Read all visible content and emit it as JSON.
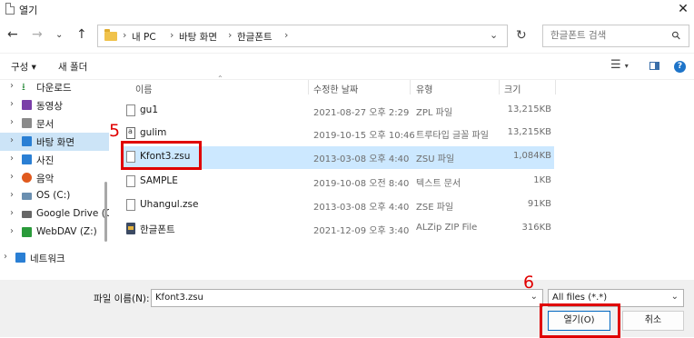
{
  "window": {
    "title": "열기",
    "close_icon": "close-icon"
  },
  "address": {
    "crumbs": [
      "내 PC",
      "바탕 화면",
      "한글폰트"
    ],
    "separator": "›"
  },
  "search": {
    "placeholder": "한글폰트 검색"
  },
  "toolbar": {
    "organize_label": "구성 ▾",
    "new_folder_label": "새 폴더"
  },
  "sidebar": {
    "items": [
      {
        "label": "다운로드",
        "icon": "download-icon",
        "color": "#2a8c3c"
      },
      {
        "label": "동영상",
        "icon": "video-icon",
        "color": "#7a3ea8"
      },
      {
        "label": "문서",
        "icon": "document-icon",
        "color": "#7a7a7a"
      },
      {
        "label": "바탕 화면",
        "icon": "desktop-icon",
        "color": "#2a7fd4"
      },
      {
        "label": "사진",
        "icon": "pictures-icon",
        "color": "#2a7fd4"
      },
      {
        "label": "음악",
        "icon": "music-icon",
        "color": "#e05a1e"
      },
      {
        "label": "OS (C:)",
        "icon": "drive-icon",
        "color": "#6a8fb0"
      },
      {
        "label": "Google Drive (G",
        "icon": "drive-icon",
        "color": "#555555"
      },
      {
        "label": "WebDAV (Z:)",
        "icon": "network-drive-icon",
        "color": "#2a9a3a"
      },
      {
        "label": "네트워크",
        "icon": "network-icon",
        "color": "#2a7fd4"
      }
    ]
  },
  "columns": {
    "name": "이름",
    "modified": "수정한 날짜",
    "type": "유형",
    "size": "크기"
  },
  "files": [
    {
      "name": "gu1",
      "modified": "2021-08-27 오후 2:29",
      "type": "ZPL 파일",
      "size": "13,215KB",
      "icon": "file-icon"
    },
    {
      "name": "gulim",
      "modified": "2019-10-15 오후 10:46",
      "type": "트루타입 글꼴 파일",
      "size": "13,215KB",
      "icon": "font-file-icon"
    },
    {
      "name": "Kfont3.zsu",
      "modified": "2013-03-08 오후 4:40",
      "type": "ZSU 파일",
      "size": "1,084KB",
      "icon": "file-icon"
    },
    {
      "name": "SAMPLE",
      "modified": "2019-10-08 오전 8:40",
      "type": "텍스트 문서",
      "size": "1KB",
      "icon": "file-icon"
    },
    {
      "name": "Uhangul.zse",
      "modified": "2013-03-08 오후 4:40",
      "type": "ZSE 파일",
      "size": "91KB",
      "icon": "file-icon"
    },
    {
      "name": "한글폰트",
      "modified": "2021-12-09 오후 3:40",
      "type": "ALZip ZIP File",
      "size": "316KB",
      "icon": "alzip-icon"
    }
  ],
  "bottom": {
    "filename_label": "파일 이름(N):",
    "filename_value": "Kfont3.zsu",
    "filetype_value": "All files (*.*)",
    "open_label": "열기(O)",
    "cancel_label": "취소"
  },
  "annotations": {
    "step5": "5",
    "step6": "6",
    "color": "#e00000"
  }
}
